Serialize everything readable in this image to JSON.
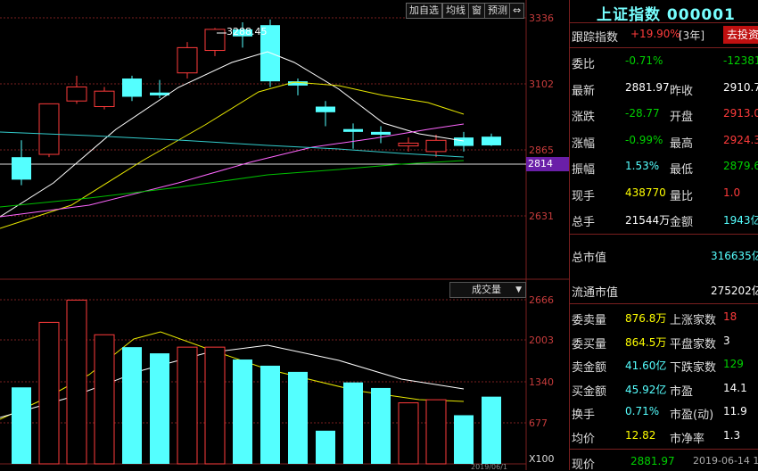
{
  "toolbar": {
    "add_self": "加自选",
    "avg_line": "均线",
    "window": "窗",
    "forecast": "预测",
    "arrow": "⇔"
  },
  "kchart": {
    "price_axis": [
      "3336",
      "3102",
      "2865",
      "2631"
    ],
    "current_marker": "2814",
    "high_label": "3288.45",
    "volume_dropdown": "成交量",
    "volume_axis": [
      "2666",
      "2003",
      "1340",
      "677"
    ],
    "volume_unit": "X100",
    "bottom_label": "2019/06/1"
  },
  "colors": {
    "up": "#ff3b3b",
    "down": "#54ffff",
    "ma5": "#ffffff",
    "ma10": "#e8e800",
    "ma20": "#ff66ff",
    "ma60": "#00c000",
    "ma_long": "#3cc",
    "grid": "#7a1f1f"
  },
  "panel": {
    "title": "上证指数 000001",
    "track_label": "跟踪指数",
    "track_value": "+19.90%",
    "track_period": "[3年]",
    "invest_button": "去投资",
    "rows1": [
      {
        "l1": "委比",
        "v1": "-0.71%",
        "c1": "green",
        "l2": "",
        "v2": "-12381",
        "c2": "green"
      },
      {
        "l1": "最新",
        "v1": "2881.97",
        "c1": "white",
        "l2": "昨收",
        "v2": "2910.7",
        "c2": "white"
      },
      {
        "l1": "涨跌",
        "v1": "-28.77",
        "c1": "green",
        "l2": "开盘",
        "v2": "2913.0",
        "c2": "red"
      },
      {
        "l1": "涨幅",
        "v1": "-0.99%",
        "c1": "green",
        "l2": "最高",
        "v2": "2924.3",
        "c2": "red"
      },
      {
        "l1": "振幅",
        "v1": "1.53%",
        "c1": "cyan",
        "l2": "最低",
        "v2": "2879.6",
        "c2": "green"
      },
      {
        "l1": "现手",
        "v1": "438770",
        "c1": "yellow",
        "l2": "量比",
        "v2": "1.0",
        "c2": "red"
      },
      {
        "l1": "总手",
        "v1": "21544万",
        "c1": "white",
        "l2": "金额",
        "v2": "1943亿",
        "c2": "cyan"
      }
    ],
    "market_cap_label": "总市值",
    "market_cap_value": "316635亿",
    "float_cap_label": "流通市值",
    "float_cap_value": "275202亿",
    "rows2": [
      {
        "l1": "委卖量",
        "v1": "876.8万",
        "c1": "yellow",
        "l2": "上涨家数",
        "v2": "18",
        "c2": "red"
      },
      {
        "l1": "委买量",
        "v1": "864.5万",
        "c1": "yellow",
        "l2": "平盘家数",
        "v2": "3",
        "c2": "white"
      },
      {
        "l1": "卖金额",
        "v1": "41.60亿",
        "c1": "cyan",
        "l2": "下跌家数",
        "v2": "129",
        "c2": "green"
      },
      {
        "l1": "买金额",
        "v1": "45.92亿",
        "c1": "cyan",
        "l2": "市盈",
        "v2": "14.1",
        "c2": "white"
      },
      {
        "l1": "换手",
        "v1": "0.71%",
        "c1": "cyan",
        "l2": "市盈(动)",
        "v2": "11.9",
        "c2": "white"
      },
      {
        "l1": "均价",
        "v1": "12.82",
        "c1": "yellow",
        "l2": "市净率",
        "v2": "1.3",
        "c2": "white"
      }
    ],
    "footer_label": "现价",
    "footer_value": "2881.97",
    "footer_date": "2019-06-14 1"
  }
}
